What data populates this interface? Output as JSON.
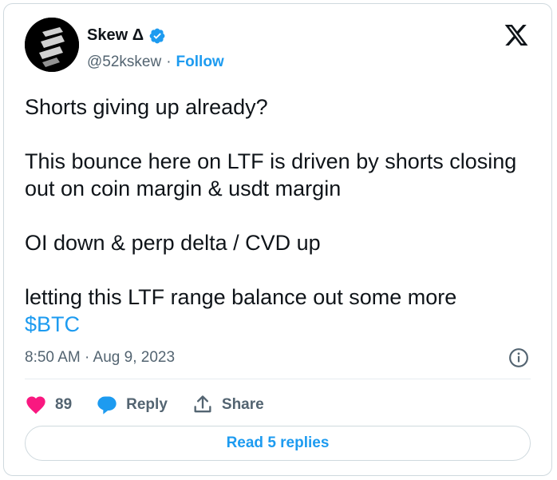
{
  "author": {
    "name": "Skew Δ",
    "handle": "@52kskew",
    "separator": "·",
    "follow_label": "Follow"
  },
  "tweet": {
    "line1": "Shorts giving up already?",
    "line2": "This bounce here on LTF is driven by shorts closing out on coin margin & usdt margin",
    "line3": "OI down & perp delta / CVD up",
    "line4": "letting this LTF range balance out some more",
    "cashtag": "$BTC"
  },
  "timestamp": "8:50 AM · Aug 9, 2023",
  "actions": {
    "likes_count": "89",
    "reply_label": "Reply",
    "share_label": "Share"
  },
  "read_replies_label": "Read 5 replies",
  "icons": {
    "verified": "verified-badge-icon",
    "logo": "x-logo-icon",
    "info": "info-icon",
    "like": "heart-icon",
    "reply": "reply-bubble-icon",
    "share": "share-icon"
  },
  "colors": {
    "accent": "#1d9bf0",
    "like": "#f91880",
    "text": "#0f1419",
    "muted": "#536471"
  }
}
